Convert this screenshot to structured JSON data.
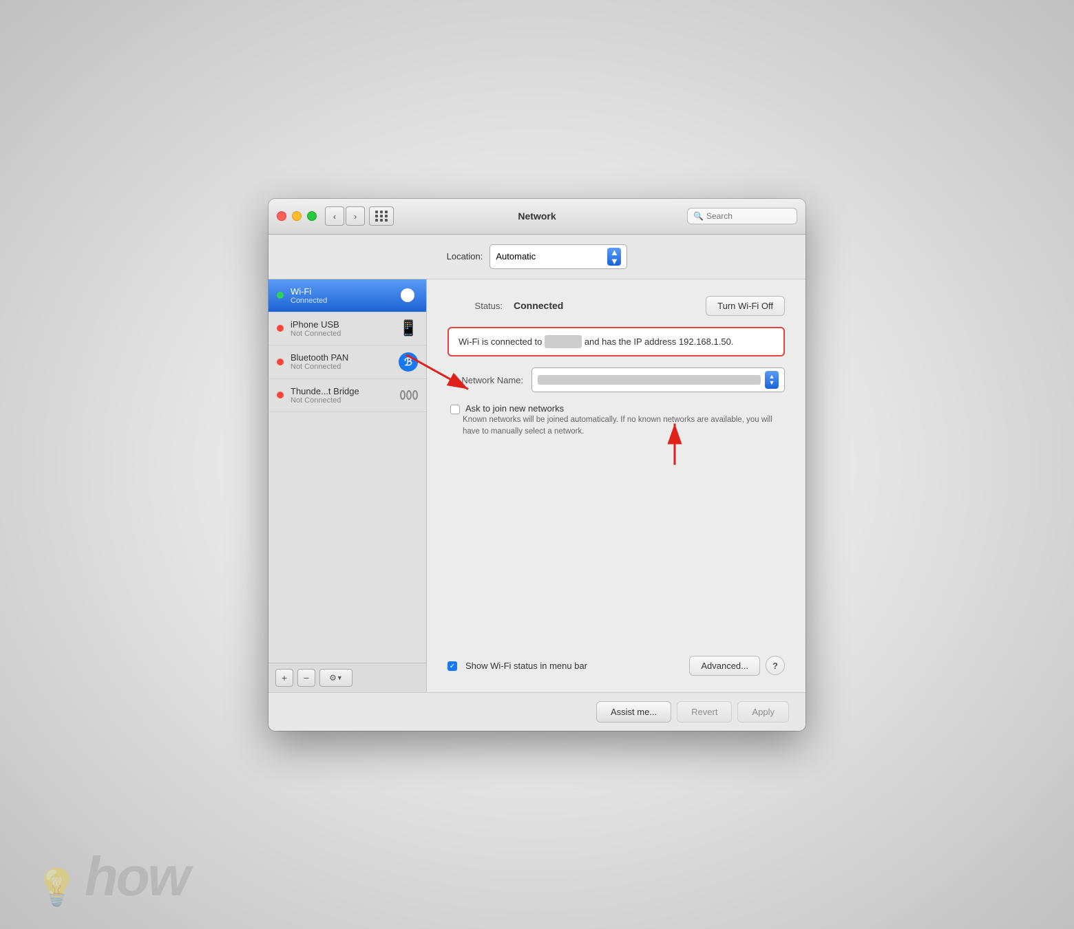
{
  "window": {
    "title": "Network",
    "search_placeholder": "Search"
  },
  "titlebar": {
    "back_btn": "‹",
    "forward_btn": "›"
  },
  "location": {
    "label": "Location:",
    "value": "Automatic"
  },
  "sidebar": {
    "items": [
      {
        "id": "wifi",
        "name": "Wi-Fi",
        "status": "Connected",
        "status_type": "connected",
        "active": true
      },
      {
        "id": "iphone-usb",
        "name": "iPhone USB",
        "status": "Not Connected",
        "status_type": "disconnected",
        "active": false
      },
      {
        "id": "bluetooth-pan",
        "name": "Bluetooth PAN",
        "status": "Not Connected",
        "status_type": "disconnected",
        "active": false
      },
      {
        "id": "thunderbolt",
        "name": "Thunde...t Bridge",
        "status": "Not Connected",
        "status_type": "disconnected",
        "active": false
      }
    ],
    "toolbar": {
      "add": "+",
      "remove": "−",
      "settings": "⚙"
    }
  },
  "detail": {
    "status_label": "Status:",
    "status_value": "Connected",
    "turn_wifi_btn": "Turn Wi-Fi Off",
    "info_text_pre": "Wi-Fi is connected to",
    "info_text_post": "and has the IP address 192.168.1.50.",
    "network_name_label": "Network Name:",
    "ask_join_label": "Ask to join new networks",
    "help_text": "Known networks will be joined automatically. If no known networks are available, you will have to manually select a network.",
    "show_wifi_label": "Show Wi-Fi status in menu bar",
    "advanced_btn": "Advanced...",
    "help_icon": "?"
  },
  "bottom_buttons": {
    "assist": "Assist me...",
    "revert": "Revert",
    "apply": "Apply"
  },
  "watermark": "how"
}
